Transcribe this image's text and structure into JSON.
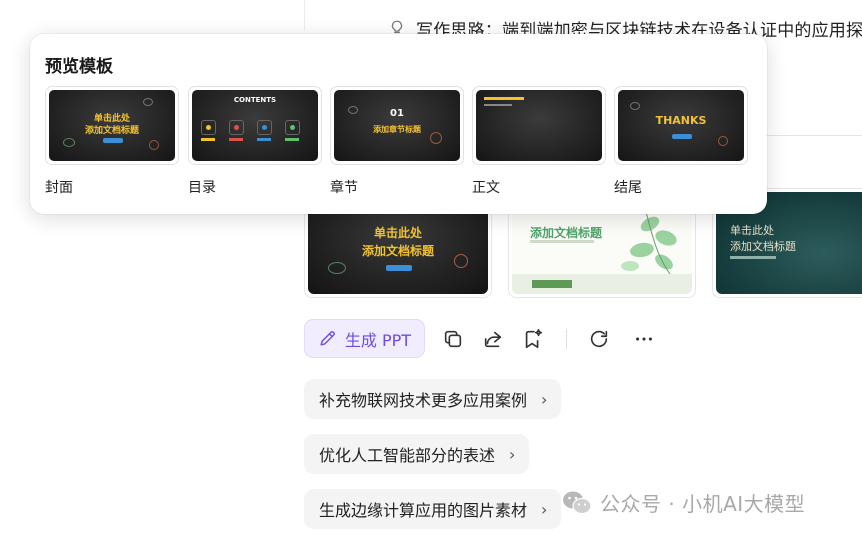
{
  "idea": {
    "text": "写作思路：端到端加密与区块链技术在设备认证中的应用探"
  },
  "popover": {
    "title": "预览模板",
    "templates": [
      {
        "label": "封面",
        "line1": "单击此处",
        "line2": "添加文档标题"
      },
      {
        "label": "目录",
        "heading": "CONTENTS"
      },
      {
        "label": "章节",
        "number": "01",
        "line1": "添加章节标题"
      },
      {
        "label": "正文"
      },
      {
        "label": "结尾",
        "line1": "THANKS"
      }
    ]
  },
  "background_thumbs": [
    {
      "line1": "单击此处",
      "line2": "添加文档标题"
    },
    {
      "line1": "添加文档标题"
    },
    {
      "line1": "单击此处",
      "line2": "添加文档标题"
    }
  ],
  "toolbar": {
    "generate_label": "生成 PPT",
    "accent": "#6d4ce0"
  },
  "suggestions": [
    {
      "label": "补充物联网技术更多应用案例"
    },
    {
      "label": "优化人工智能部分的表述"
    },
    {
      "label": "生成边缘计算应用的图片素材"
    }
  ],
  "watermark": {
    "text": "公众号 · 小机AI大模型"
  }
}
